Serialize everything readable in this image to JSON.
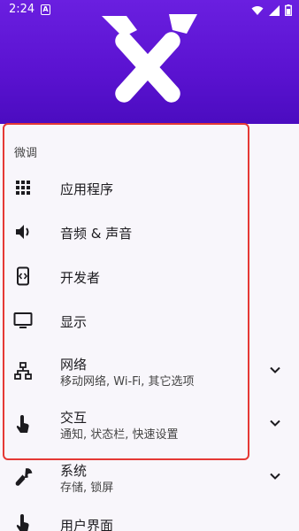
{
  "status_bar": {
    "time": "2:24",
    "notification_badge": "A"
  },
  "section": {
    "title": "微调"
  },
  "items": [
    {
      "label": "应用程序",
      "icon": "apps-grid-icon"
    },
    {
      "label": "音频 & 声音",
      "icon": "volume-icon"
    },
    {
      "label": "开发者",
      "icon": "developer-icon"
    },
    {
      "label": "显示",
      "icon": "display-icon"
    },
    {
      "label": "网络",
      "sub": "移动网络, Wi-Fi, 其它选项",
      "icon": "network-icon",
      "expandable": true
    },
    {
      "label": "交互",
      "sub": "通知, 状态栏, 快速设置",
      "icon": "touch-icon",
      "expandable": true
    },
    {
      "label": "系统",
      "sub": "存储, 锁屏",
      "icon": "wrench-icon",
      "expandable": true
    },
    {
      "label": "用户界面",
      "icon": "ui-icon"
    }
  ],
  "colors": {
    "header_top": "#6a1fe0",
    "header_bottom": "#4b0cc0",
    "highlight": "#e53935"
  }
}
